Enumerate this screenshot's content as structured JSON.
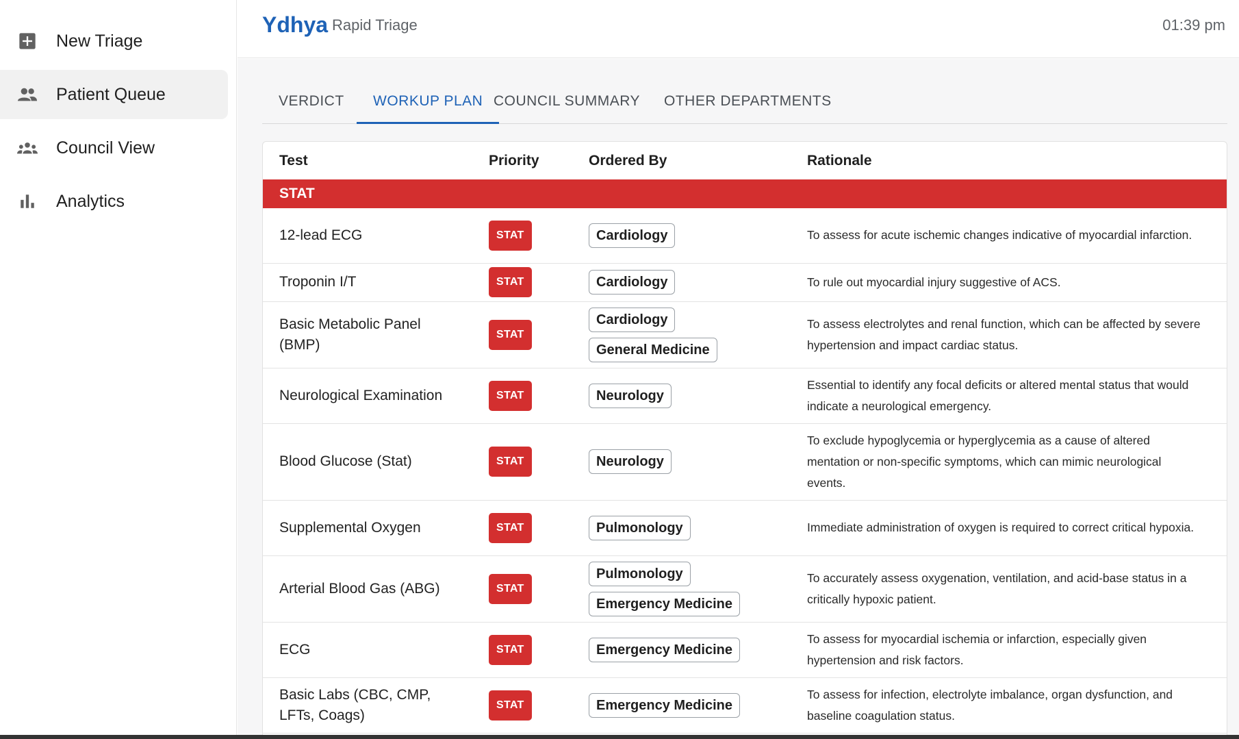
{
  "sidebar": {
    "items": [
      {
        "label": "New Triage",
        "icon": "add-box-icon"
      },
      {
        "label": "Patient Queue",
        "icon": "people-icon",
        "active": true
      },
      {
        "label": "Council View",
        "icon": "groups-icon"
      },
      {
        "label": "Analytics",
        "icon": "bar-chart-icon"
      }
    ]
  },
  "header": {
    "brand": "Ydhya",
    "subtitle": "Rapid Triage",
    "time": "01:39 pm"
  },
  "tabs": [
    {
      "label": "VERDICT"
    },
    {
      "label": "WORKUP PLAN",
      "active": true
    },
    {
      "label": "COUNCIL SUMMARY"
    },
    {
      "label": "OTHER DEPARTMENTS"
    }
  ],
  "table": {
    "headers": [
      "Test",
      "Priority",
      "Ordered By",
      "Rationale"
    ],
    "group_label": "STAT",
    "rows": [
      {
        "test": "12-lead ECG",
        "priority": "STAT",
        "ordered_by": [
          "Cardiology"
        ],
        "rationale": "To assess for acute ischemic changes indicative of myocardial infarction."
      },
      {
        "test": "Troponin I/T",
        "priority": "STAT",
        "ordered_by": [
          "Cardiology"
        ],
        "rationale": "To rule out myocardial injury suggestive of ACS."
      },
      {
        "test": "Basic Metabolic Panel (BMP)",
        "priority": "STAT",
        "ordered_by": [
          "Cardiology",
          "General Medicine"
        ],
        "rationale": "To assess electrolytes and renal function, which can be affected by severe hypertension and impact cardiac status."
      },
      {
        "test": "Neurological Examination",
        "priority": "STAT",
        "ordered_by": [
          "Neurology"
        ],
        "rationale": "Essential to identify any focal deficits or altered mental status that would indicate a neurological emergency."
      },
      {
        "test": "Blood Glucose (Stat)",
        "priority": "STAT",
        "ordered_by": [
          "Neurology"
        ],
        "rationale": "To exclude hypoglycemia or hyperglycemia as a cause of altered mentation or non-specific symptoms, which can mimic neurological events."
      },
      {
        "test": "Supplemental Oxygen",
        "priority": "STAT",
        "ordered_by": [
          "Pulmonology"
        ],
        "rationale": "Immediate administration of oxygen is required to correct critical hypoxia."
      },
      {
        "test": "Arterial Blood Gas (ABG)",
        "priority": "STAT",
        "ordered_by": [
          "Pulmonology",
          "Emergency Medicine"
        ],
        "rationale": "To accurately assess oxygenation, ventilation, and acid-base status in a critically hypoxic patient."
      },
      {
        "test": "ECG",
        "priority": "STAT",
        "ordered_by": [
          "Emergency Medicine"
        ],
        "rationale": "To assess for myocardial ischemia or infarction, especially given hypertension and risk factors."
      },
      {
        "test": "Basic Labs (CBC, CMP, LFTs, Coags)",
        "priority": "STAT",
        "ordered_by": [
          "Emergency Medicine"
        ],
        "rationale": "To assess for infection, electrolyte imbalance, organ dysfunction, and baseline coagulation status."
      }
    ]
  },
  "colors": {
    "brand": "#1e62b6",
    "stat": "#d32f2f"
  }
}
